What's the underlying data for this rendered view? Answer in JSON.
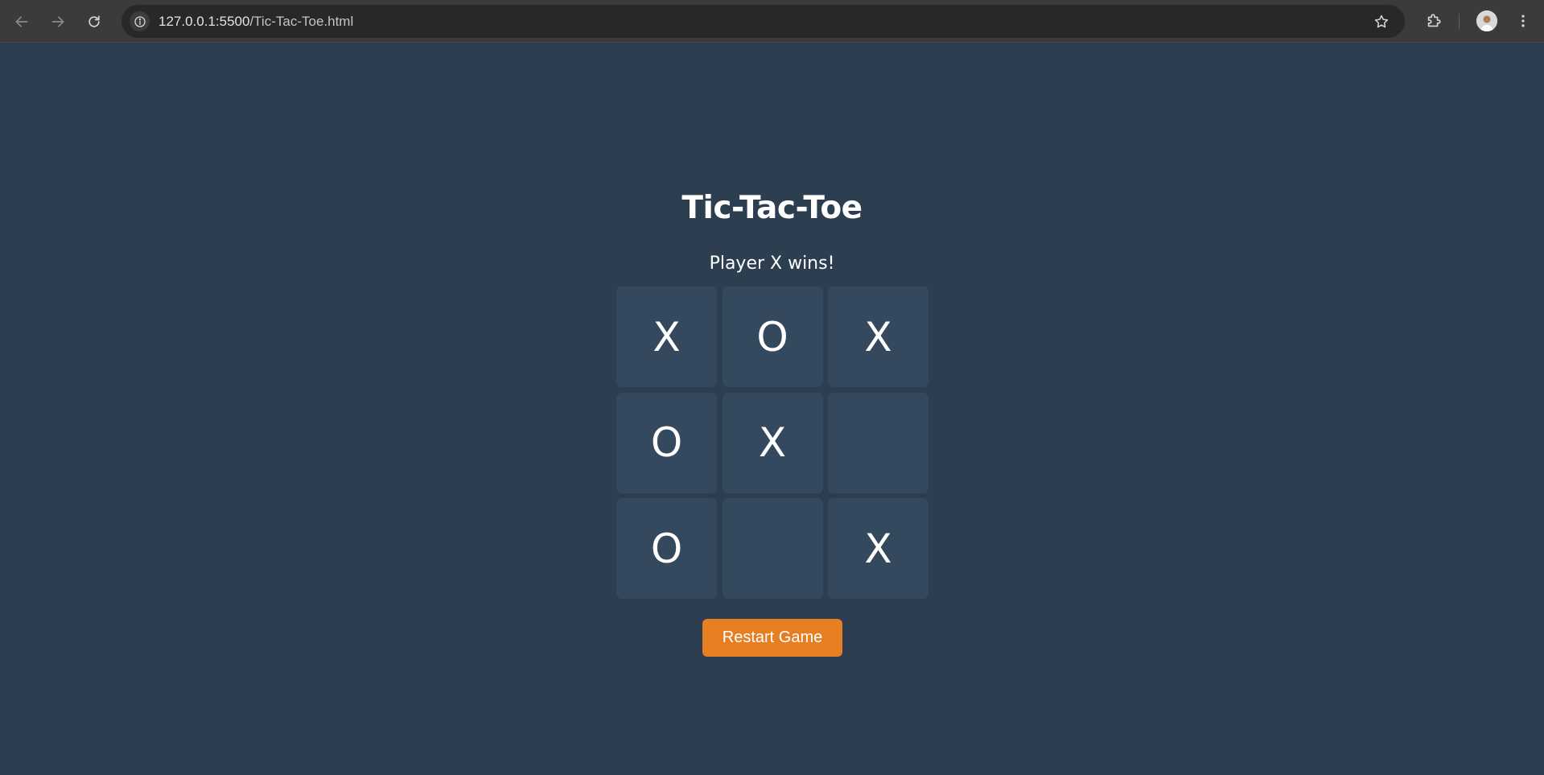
{
  "browser": {
    "url_host": "127.0.0.1:5500",
    "url_path": "/Tic-Tac-Toe.html",
    "icons": {
      "back": "arrow-left-icon",
      "forward": "arrow-right-icon",
      "reload": "reload-icon",
      "site_info": "info-icon",
      "bookmark": "star-icon",
      "extensions": "puzzle-icon",
      "menu": "kebab-menu-icon"
    }
  },
  "game": {
    "title": "Tic-Tac-Toe",
    "status": "Player X wins!",
    "board": [
      "X",
      "O",
      "X",
      "O",
      "X",
      "",
      "O",
      "",
      "X"
    ],
    "restart_label": "Restart Game"
  },
  "colors": {
    "background": "#2c3e50",
    "cell": "#34495e",
    "button": "#e67e22",
    "text": "#ffffff"
  }
}
